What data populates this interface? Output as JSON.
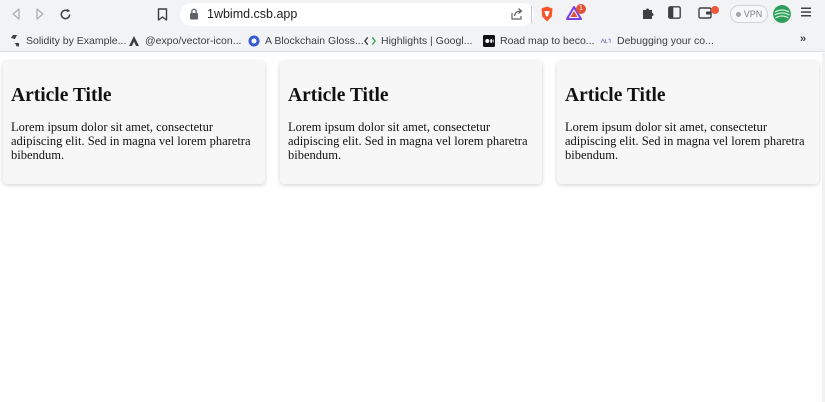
{
  "browser": {
    "url": "1wbimd.csb.app",
    "vpn_label": "VPN",
    "rewards_count": "1",
    "colors": {
      "toolbar_bg": "#f1f3f4",
      "brave_orange": "#fb542b",
      "badge_red": "#e0533a"
    }
  },
  "bookmarks": {
    "items": [
      {
        "label": "Solidity by Example...",
        "icon": "solidity-icon"
      },
      {
        "label": "@expo/vector-icon...",
        "icon": "expo-icon"
      },
      {
        "label": "A Blockchain Gloss...",
        "icon": "chainlink-icon"
      },
      {
        "label": "Highlights  |  Googl...",
        "icon": "code-icon"
      },
      {
        "label": "Road map to beco...",
        "icon": "medium-icon"
      },
      {
        "label": "Debugging your co...",
        "icon": "debug-icon"
      }
    ],
    "more_label": "»"
  },
  "cards": [
    {
      "title": "Article Title",
      "body": "Lorem ipsum dolor sit amet, consectetur adipiscing elit. Sed in magna vel lorem pharetra bibendum."
    },
    {
      "title": "Article Title",
      "body": "Lorem ipsum dolor sit amet, consectetur adipiscing elit. Sed in magna vel lorem pharetra bibendum."
    },
    {
      "title": "Article Title",
      "body": "Lorem ipsum dolor sit amet, consectetur adipiscing elit. Sed in magna vel lorem pharetra bibendum."
    }
  ]
}
